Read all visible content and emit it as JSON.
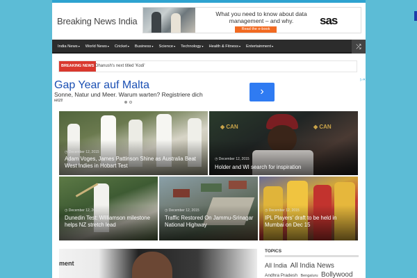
{
  "site": {
    "title": "Breaking News India"
  },
  "header_ad": {
    "text": "What you need to know about data management – and why.",
    "button": "Read the e-book",
    "logo": "sas"
  },
  "nav": {
    "items": [
      {
        "label": "India News"
      },
      {
        "label": "World News"
      },
      {
        "label": "Cricket"
      },
      {
        "label": "Business"
      },
      {
        "label": "Science"
      },
      {
        "label": "Technology"
      },
      {
        "label": "Health & Fitness"
      },
      {
        "label": "Entertainment"
      }
    ],
    "caret": "▾",
    "shuffle_icon": "⤮"
  },
  "breaking": {
    "label": "BREAKING NEWS",
    "headline": "Dhanush's next titled 'Kodi'"
  },
  "text_ad": {
    "title": "Gap Year auf Malta",
    "subtitle": "Sonne, Natur und Meer. Warum warten? Registriere dich",
    "cutoff": "jetzt!",
    "arrow": "›",
    "corner": "▷✕"
  },
  "tiles": [
    {
      "date": "◷ December 12, 2015",
      "title": "Adam Voges, James Pattinson Shine as Australia Beat West Indies in Hobart Test"
    },
    {
      "date": "◷ December 12, 2015",
      "title": "Holder and WI search for inspiration"
    },
    {
      "date": "◷ December 12, 2015",
      "title": "Dunedin Test: Williamson milestone helps NZ stretch lead"
    },
    {
      "date": "◷ December 12, 2015",
      "title": "Traffic Restored On Jammu-Srinagar National Highway"
    },
    {
      "date": "◷ December 12, 2015",
      "title": "IPL Players' draft to be held in Mumbai on Dec 15"
    }
  ],
  "lower": {
    "brand": "ment"
  },
  "topics": {
    "heading": "TOPICS",
    "tags": [
      {
        "label": "All India",
        "size": "9px"
      },
      {
        "label": "All India News",
        "size": "10px"
      },
      {
        "label": "Andhra Pradesh",
        "size": "6.5px"
      },
      {
        "label": "Bengaluru",
        "size": "5.5px"
      },
      {
        "label": "Bollywood",
        "size": "10px"
      }
    ]
  },
  "colors": {
    "background": "#5cbcd6",
    "breaking_red": "#d9382e",
    "nav_dark": "#2c2c2c",
    "ad_link_blue": "#1a4fb3",
    "ad_button_blue": "#2f7bf2"
  }
}
